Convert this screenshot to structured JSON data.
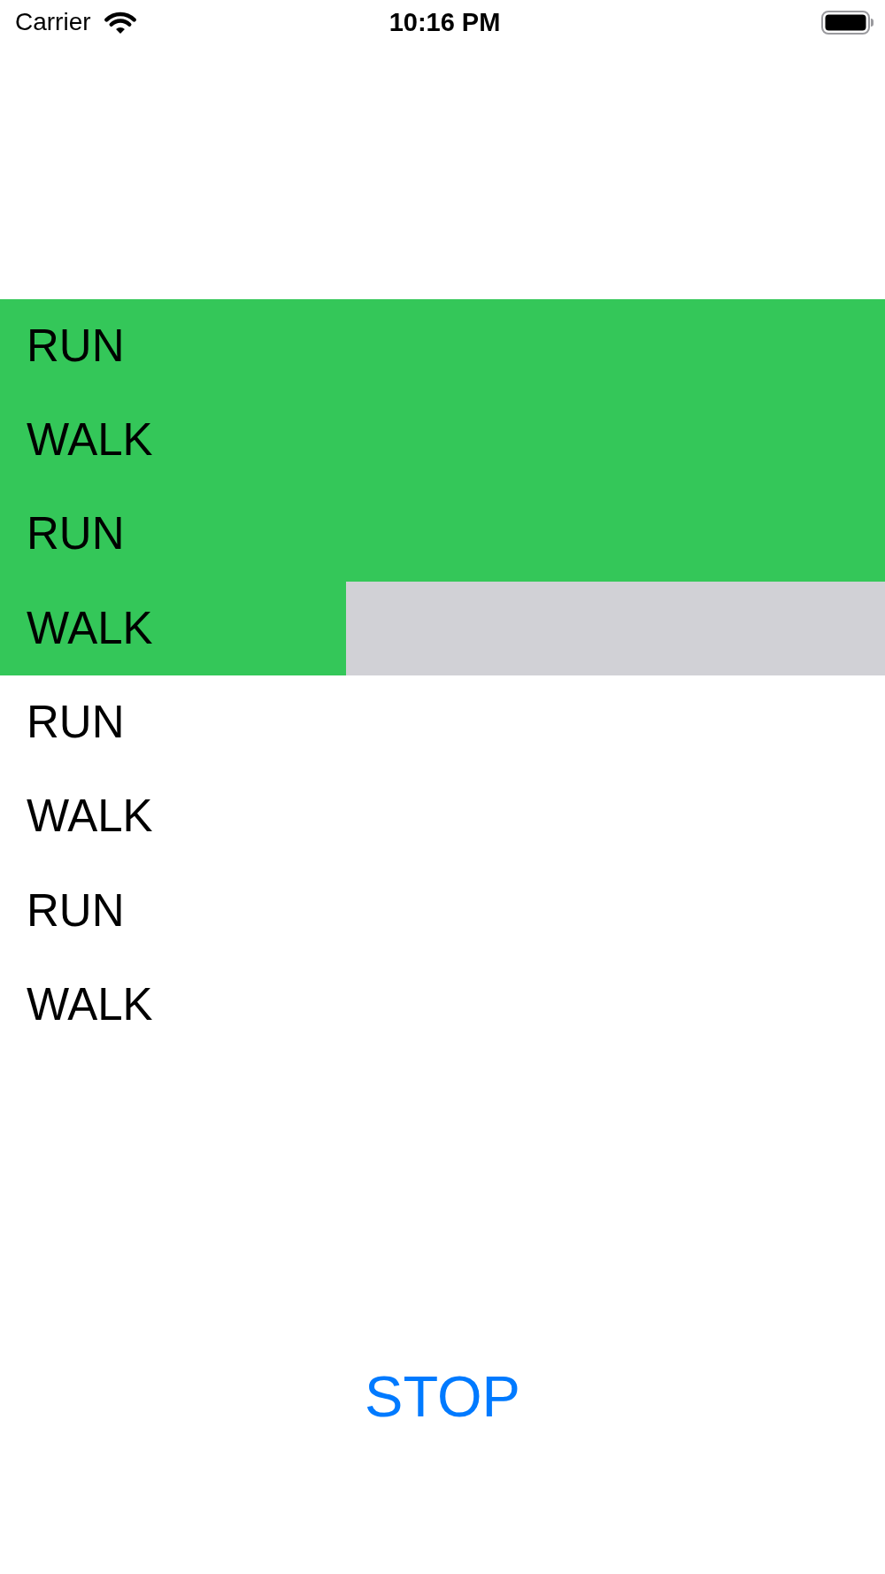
{
  "status_bar": {
    "carrier": "Carrier",
    "time": "10:16 PM"
  },
  "activity_list": {
    "rows": [
      {
        "label": "RUN",
        "kind": "done"
      },
      {
        "label": "WALK",
        "kind": "done"
      },
      {
        "label": "RUN",
        "kind": "done"
      },
      {
        "label": "WALK",
        "kind": "active",
        "level": 0.391
      },
      {
        "label": "RUN",
        "kind": "pending"
      },
      {
        "label": "WALK",
        "kind": "pending"
      },
      {
        "label": "RUN",
        "kind": "pending"
      },
      {
        "label": "WALK",
        "kind": "pending"
      }
    ]
  },
  "stop_button": {
    "label": "STOP"
  }
}
